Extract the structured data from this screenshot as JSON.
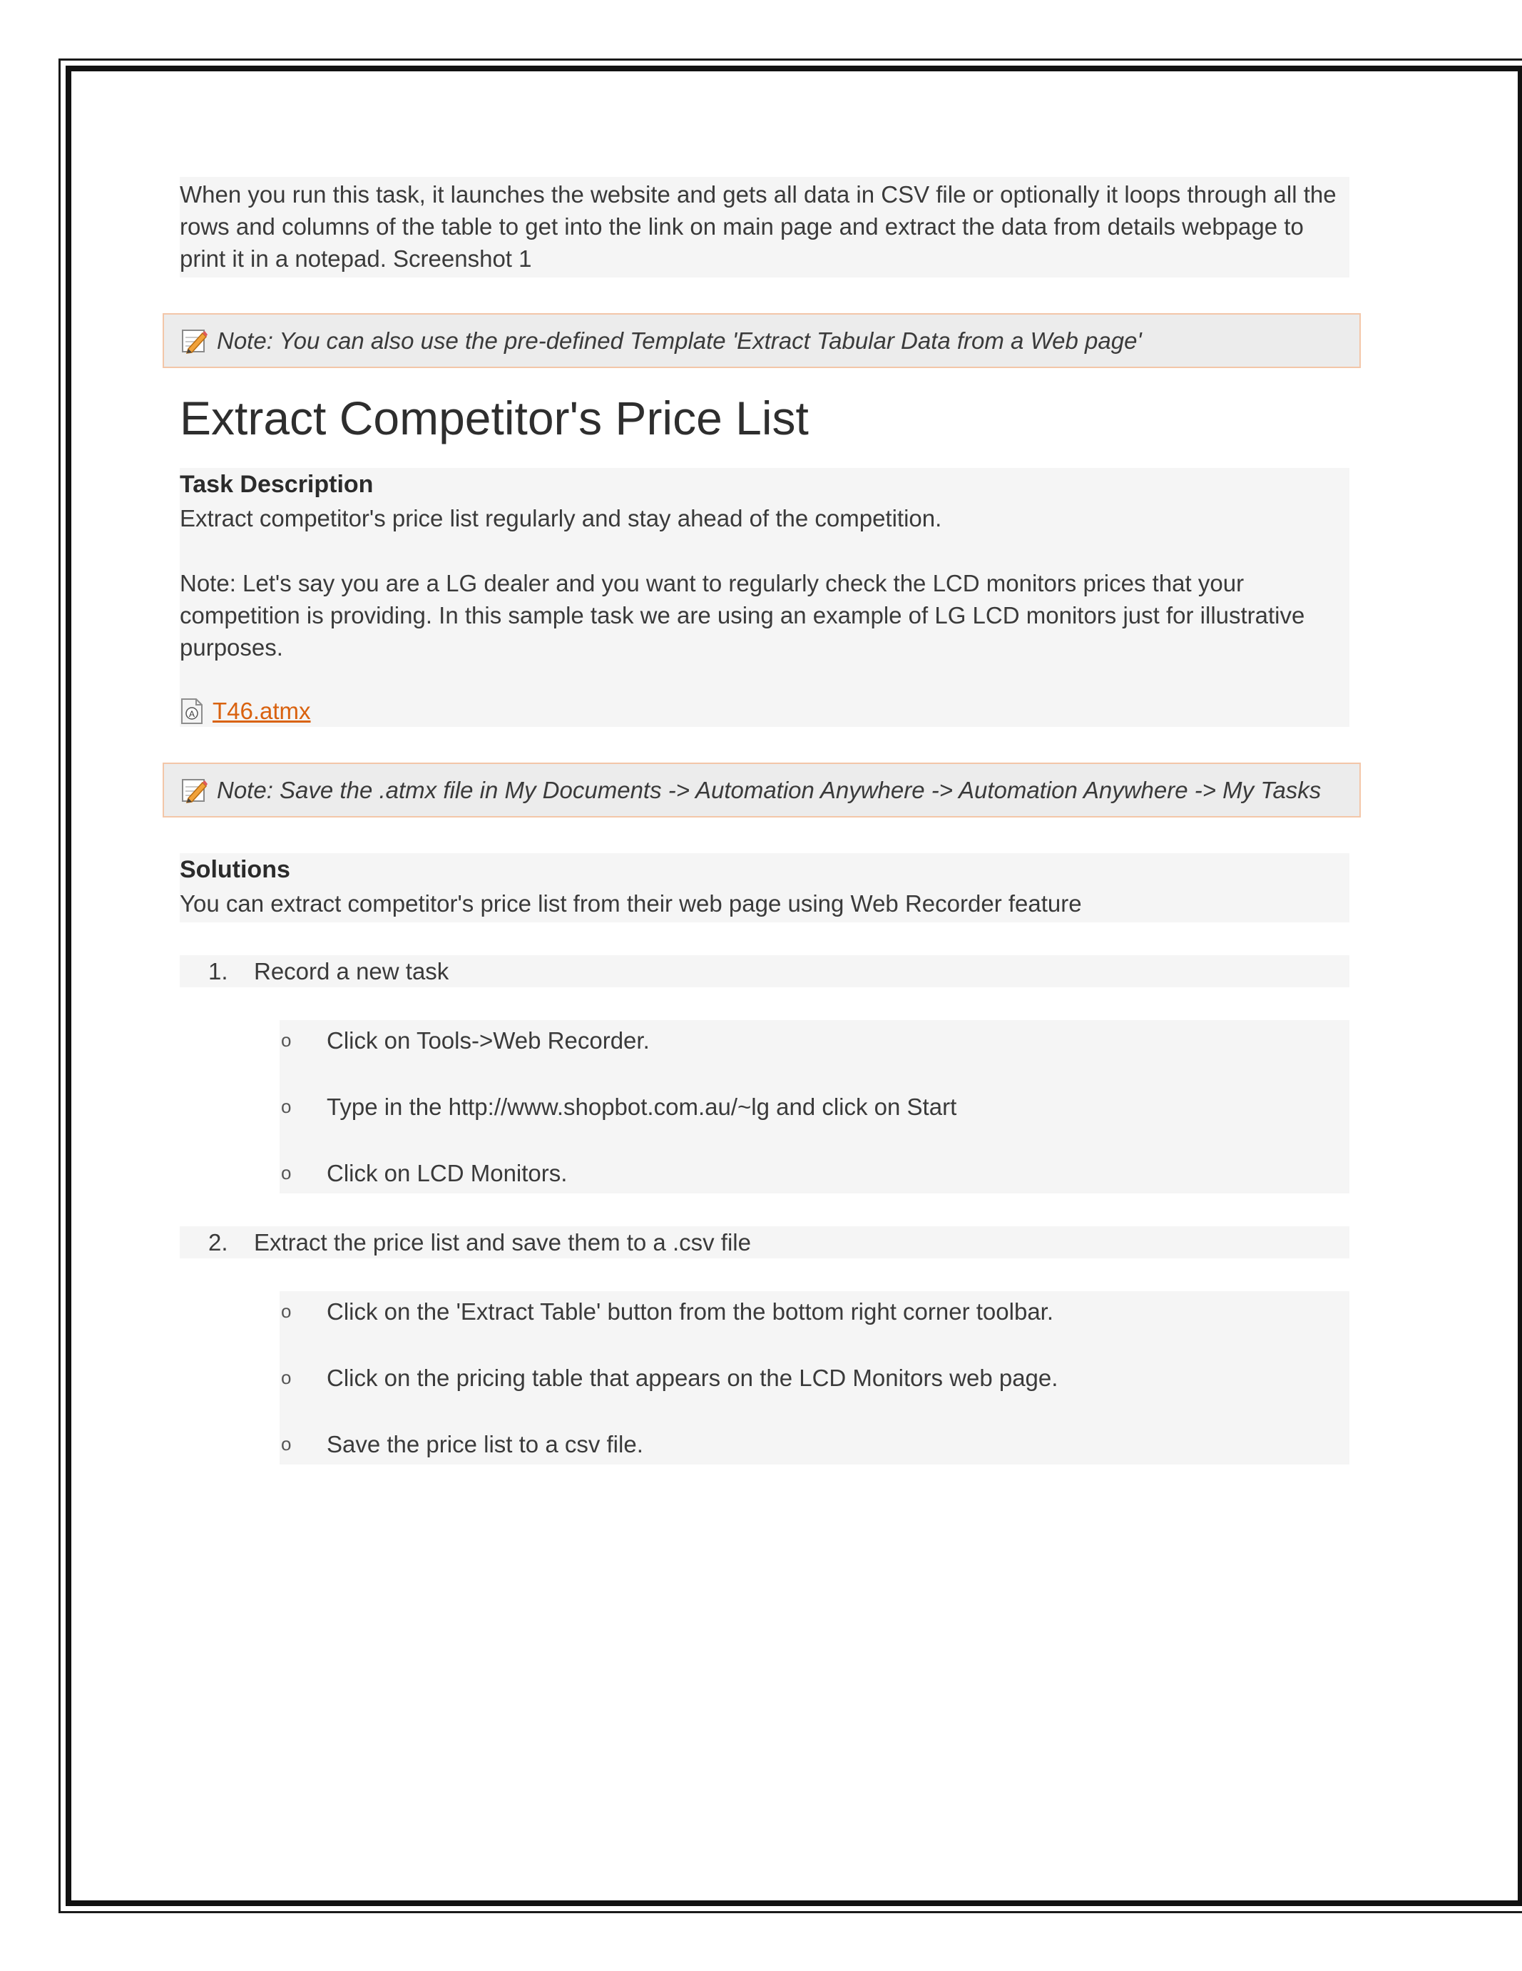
{
  "intro": {
    "text": "When you run this task, it launches the website and gets all data in CSV file or optionally it loops through all the rows and columns of the table to get into the link on main page and extract the data from details webpage to print it in a notepad. Screenshot 1"
  },
  "note_template": {
    "text": "Note: You can also use the pre-defined Template 'Extract Tabular Data from a Web page'"
  },
  "title": "Extract Competitor's Price List",
  "task_description": {
    "heading": "Task Description",
    "summary": "Extract competitor's price list regularly and stay ahead of the competition.",
    "note": "Note: Let's say you are a LG dealer and you want to regularly check the LCD monitors prices that your competition is providing. In this sample task we are using an example of LG LCD monitors just for illustrative purposes.",
    "attachment": "T46.atmx"
  },
  "note_save": {
    "text": "Note: Save the .atmx file in My Documents -> Automation Anywhere -> Automation Anywhere -> My Tasks"
  },
  "solutions": {
    "heading": "Solutions",
    "summary": "You can extract competitor's price list from their web page using Web Recorder feature",
    "steps": [
      {
        "number": "1.",
        "label": "Record a new task",
        "substeps": [
          "Click on Tools->Web Recorder.",
          "Type in the http://www.shopbot.com.au/~lg and click on Start",
          "Click on LCD Monitors."
        ]
      },
      {
        "number": "2.",
        "label": "Extract the price list and save them to a .csv file",
        "substeps": [
          "Click on the 'Extract Table' button from the bottom right corner toolbar.",
          "Click on the pricing table that appears on the LCD Monitors web page.",
          "Save the price list to a csv file."
        ]
      }
    ]
  },
  "bullet_symbol": "o",
  "icons": {
    "note": "pencil-note-icon",
    "attachment": "file-icon"
  }
}
